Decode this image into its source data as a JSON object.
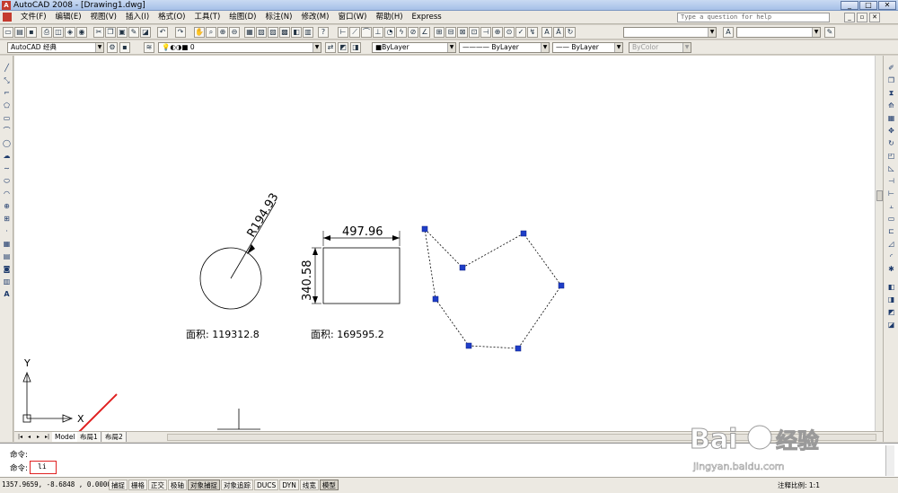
{
  "window": {
    "title": "AutoCAD 2008 - [Drawing1.dwg]",
    "min_label": "_",
    "max_label": "□",
    "close_label": "✕"
  },
  "menu": {
    "items": [
      "文件(F)",
      "编辑(E)",
      "视图(V)",
      "插入(I)",
      "格式(O)",
      "工具(T)",
      "绘图(D)",
      "标注(N)",
      "修改(M)",
      "窗口(W)",
      "帮助(H)",
      "Express"
    ],
    "help_placeholder": "Type a question for help"
  },
  "toolbar2": {
    "workspace": "AutoCAD 经典",
    "layer": "0",
    "color": "■ByLayer",
    "linetype": "ByLayer",
    "lineweight": "ByLayer",
    "plotstyle": "ByColor"
  },
  "drawing": {
    "circle_radius_label": "R194.93",
    "circle_area_label": "面积: 119312.8",
    "rect_width_label": "497.96",
    "rect_height_label": "340.58",
    "rect_area_label": "面积: 169595.2",
    "ucs_x": "X",
    "ucs_y": "Y"
  },
  "tabs": {
    "model": "Model",
    "layout1": "布局1",
    "layout2": "布局2"
  },
  "command": {
    "line1_prompt": "命令:",
    "line2_prompt": "命令:",
    "input_value": "li"
  },
  "status": {
    "coords": "1357.9659, -8.6848 , 0.0000",
    "toggles": [
      "捕捉",
      "栅格",
      "正交",
      "极轴",
      "对象捕捉",
      "对象追踪",
      "DUCS",
      "DYN",
      "线宽",
      "模型"
    ],
    "annotation_scale": "注释比例: 1:1"
  },
  "watermark": {
    "brand": "Bai",
    "brand2": "经验",
    "url": "jingyan.baidu.com"
  },
  "colors": {
    "grip": "#1f3ec8",
    "arrow": "#e02020",
    "titlebar": "#a6c0e8"
  }
}
